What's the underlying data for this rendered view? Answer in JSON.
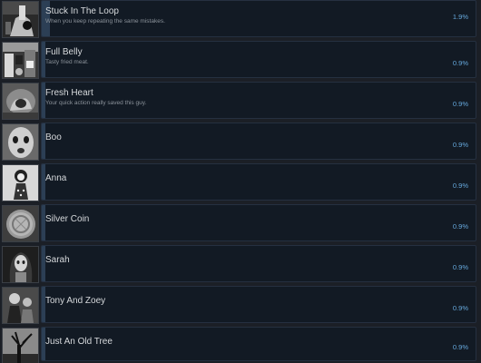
{
  "achievements": [
    {
      "title": "Stuck In The Loop",
      "description": "When you keep repeating the same mistakes.",
      "percent": "1.9%",
      "percent_value": 1.9,
      "icon": "hand-holding-object-icon"
    },
    {
      "title": "Full Belly",
      "description": "Tasty fried meat.",
      "percent": "0.9%",
      "percent_value": 0.9,
      "icon": "kitchen-scene-icon"
    },
    {
      "title": "Fresh Heart",
      "description": "Your quick action really saved this guy.",
      "percent": "0.9%",
      "percent_value": 0.9,
      "icon": "hands-heart-icon"
    },
    {
      "title": "Boo",
      "description": "",
      "percent": "0.9%",
      "percent_value": 0.9,
      "icon": "ghost-face-icon"
    },
    {
      "title": "Anna",
      "description": "",
      "percent": "0.9%",
      "percent_value": 0.9,
      "icon": "doll-icon"
    },
    {
      "title": "Silver Coin",
      "description": "",
      "percent": "0.9%",
      "percent_value": 0.9,
      "icon": "coin-icon"
    },
    {
      "title": "Sarah",
      "description": "",
      "percent": "0.9%",
      "percent_value": 0.9,
      "icon": "pale-woman-icon"
    },
    {
      "title": "Tony And Zoey",
      "description": "",
      "percent": "0.9%",
      "percent_value": 0.9,
      "icon": "two-figures-icon"
    },
    {
      "title": "Just An Old Tree",
      "description": "",
      "percent": "0.9%",
      "percent_value": 0.9,
      "icon": "tree-icon"
    }
  ],
  "colors": {
    "background": "#1b1f26",
    "panel": "#121a24",
    "panel_border": "#253040",
    "progress_fill": "#2c3f55",
    "title_text": "#d6d9dc",
    "description_text": "#8b929a",
    "percent_text": "#66a8dc"
  }
}
